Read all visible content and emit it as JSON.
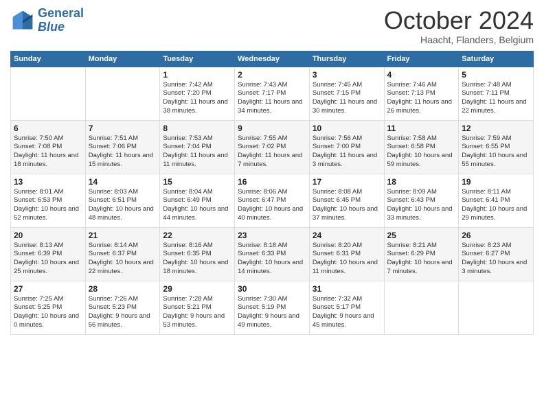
{
  "header": {
    "logo_line1": "General",
    "logo_line2": "Blue",
    "month": "October 2024",
    "location": "Haacht, Flanders, Belgium"
  },
  "weekdays": [
    "Sunday",
    "Monday",
    "Tuesday",
    "Wednesday",
    "Thursday",
    "Friday",
    "Saturday"
  ],
  "weeks": [
    [
      {
        "day": "",
        "info": ""
      },
      {
        "day": "",
        "info": ""
      },
      {
        "day": "1",
        "info": "Sunrise: 7:42 AM\nSunset: 7:20 PM\nDaylight: 11 hours and 38 minutes."
      },
      {
        "day": "2",
        "info": "Sunrise: 7:43 AM\nSunset: 7:17 PM\nDaylight: 11 hours and 34 minutes."
      },
      {
        "day": "3",
        "info": "Sunrise: 7:45 AM\nSunset: 7:15 PM\nDaylight: 11 hours and 30 minutes."
      },
      {
        "day": "4",
        "info": "Sunrise: 7:46 AM\nSunset: 7:13 PM\nDaylight: 11 hours and 26 minutes."
      },
      {
        "day": "5",
        "info": "Sunrise: 7:48 AM\nSunset: 7:11 PM\nDaylight: 11 hours and 22 minutes."
      }
    ],
    [
      {
        "day": "6",
        "info": "Sunrise: 7:50 AM\nSunset: 7:08 PM\nDaylight: 11 hours and 18 minutes."
      },
      {
        "day": "7",
        "info": "Sunrise: 7:51 AM\nSunset: 7:06 PM\nDaylight: 11 hours and 15 minutes."
      },
      {
        "day": "8",
        "info": "Sunrise: 7:53 AM\nSunset: 7:04 PM\nDaylight: 11 hours and 11 minutes."
      },
      {
        "day": "9",
        "info": "Sunrise: 7:55 AM\nSunset: 7:02 PM\nDaylight: 11 hours and 7 minutes."
      },
      {
        "day": "10",
        "info": "Sunrise: 7:56 AM\nSunset: 7:00 PM\nDaylight: 11 hours and 3 minutes."
      },
      {
        "day": "11",
        "info": "Sunrise: 7:58 AM\nSunset: 6:58 PM\nDaylight: 10 hours and 59 minutes."
      },
      {
        "day": "12",
        "info": "Sunrise: 7:59 AM\nSunset: 6:55 PM\nDaylight: 10 hours and 55 minutes."
      }
    ],
    [
      {
        "day": "13",
        "info": "Sunrise: 8:01 AM\nSunset: 6:53 PM\nDaylight: 10 hours and 52 minutes."
      },
      {
        "day": "14",
        "info": "Sunrise: 8:03 AM\nSunset: 6:51 PM\nDaylight: 10 hours and 48 minutes."
      },
      {
        "day": "15",
        "info": "Sunrise: 8:04 AM\nSunset: 6:49 PM\nDaylight: 10 hours and 44 minutes."
      },
      {
        "day": "16",
        "info": "Sunrise: 8:06 AM\nSunset: 6:47 PM\nDaylight: 10 hours and 40 minutes."
      },
      {
        "day": "17",
        "info": "Sunrise: 8:08 AM\nSunset: 6:45 PM\nDaylight: 10 hours and 37 minutes."
      },
      {
        "day": "18",
        "info": "Sunrise: 8:09 AM\nSunset: 6:43 PM\nDaylight: 10 hours and 33 minutes."
      },
      {
        "day": "19",
        "info": "Sunrise: 8:11 AM\nSunset: 6:41 PM\nDaylight: 10 hours and 29 minutes."
      }
    ],
    [
      {
        "day": "20",
        "info": "Sunrise: 8:13 AM\nSunset: 6:39 PM\nDaylight: 10 hours and 25 minutes."
      },
      {
        "day": "21",
        "info": "Sunrise: 8:14 AM\nSunset: 6:37 PM\nDaylight: 10 hours and 22 minutes."
      },
      {
        "day": "22",
        "info": "Sunrise: 8:16 AM\nSunset: 6:35 PM\nDaylight: 10 hours and 18 minutes."
      },
      {
        "day": "23",
        "info": "Sunrise: 8:18 AM\nSunset: 6:33 PM\nDaylight: 10 hours and 14 minutes."
      },
      {
        "day": "24",
        "info": "Sunrise: 8:20 AM\nSunset: 6:31 PM\nDaylight: 10 hours and 11 minutes."
      },
      {
        "day": "25",
        "info": "Sunrise: 8:21 AM\nSunset: 6:29 PM\nDaylight: 10 hours and 7 minutes."
      },
      {
        "day": "26",
        "info": "Sunrise: 8:23 AM\nSunset: 6:27 PM\nDaylight: 10 hours and 3 minutes."
      }
    ],
    [
      {
        "day": "27",
        "info": "Sunrise: 7:25 AM\nSunset: 5:25 PM\nDaylight: 10 hours and 0 minutes."
      },
      {
        "day": "28",
        "info": "Sunrise: 7:26 AM\nSunset: 5:23 PM\nDaylight: 9 hours and 56 minutes."
      },
      {
        "day": "29",
        "info": "Sunrise: 7:28 AM\nSunset: 5:21 PM\nDaylight: 9 hours and 53 minutes."
      },
      {
        "day": "30",
        "info": "Sunrise: 7:30 AM\nSunset: 5:19 PM\nDaylight: 9 hours and 49 minutes."
      },
      {
        "day": "31",
        "info": "Sunrise: 7:32 AM\nSunset: 5:17 PM\nDaylight: 9 hours and 45 minutes."
      },
      {
        "day": "",
        "info": ""
      },
      {
        "day": "",
        "info": ""
      }
    ]
  ]
}
